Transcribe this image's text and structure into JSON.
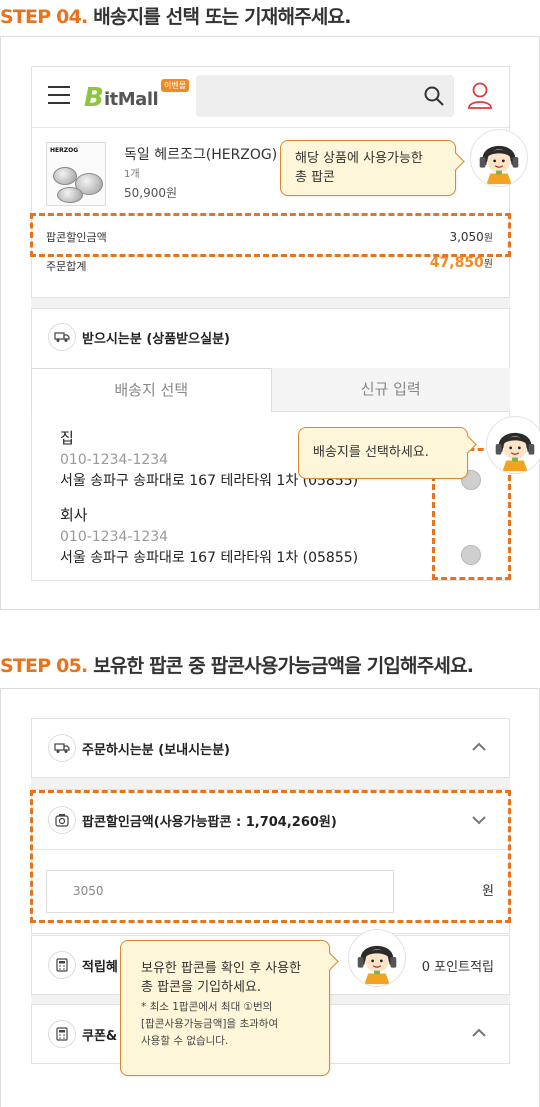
{
  "step4": {
    "num": "STEP 04.",
    "text": " 배송지를 선택 또는 기재해주세요."
  },
  "step5": {
    "num": "STEP 05.",
    "text": " 보유한 팝콘 중 팝콘사용가능금액을 기입해주세요."
  },
  "header": {
    "logo_b": "B",
    "logo_text": "itMall",
    "logo_tag": "이벤몰"
  },
  "product": {
    "brand": "HERZOG",
    "name": "독일 헤르조그(HERZOG)",
    "qty": "1개",
    "price": "50,900원",
    "discount_label": "팝콘할인금액",
    "discount_value": "3,050",
    "discount_unit": "원",
    "total_label": "주문합계",
    "total_value": "47,850",
    "total_unit": "원"
  },
  "recipient": {
    "title": "받으시는분 (상품받으실분)",
    "tab_select": "배송지 선택",
    "tab_new": "신규 입력",
    "addresses": [
      {
        "name": "집",
        "phone": "010-1234-1234",
        "address": "서울 송파구 송파대로 167 테라타워 1차 (05855)"
      },
      {
        "name": "회사",
        "phone": "010-1234-1234",
        "address": "서울 송파구 송파대로 167 테라타워 1차 (05855)"
      }
    ]
  },
  "tips": {
    "tip1_line1": "해당 상품에 사용가능한",
    "tip1_line2": "총 팝콘",
    "tip2": "배송지를 선택하세요.",
    "tip3_line1": "보유한 팝콘를 확인 후 사용한",
    "tip3_line2": "총 팝콘을 기입하세요.",
    "tip3_note1": "* 최소 1팝콘에서 최대 ①번의",
    "tip3_note2": "[팝콘사용가능금액]을 초과하여",
    "tip3_note3": "사용할 수 없습니다."
  },
  "payment": {
    "orderer_title": "주문하시는분 (보내시는분)",
    "popcorn_title": "팝콘할인금액(사용가능팝콘 : 1,704,260원)",
    "popcorn_input": "3050",
    "won": "원",
    "points_title": "적립혜",
    "points_text": "0 포인트적립",
    "coupon_title": "쿠폰&"
  },
  "colors": {
    "accent": "#e8731e",
    "tip_bg": "#fdf6d8",
    "logo_green": "#8cc63f"
  }
}
